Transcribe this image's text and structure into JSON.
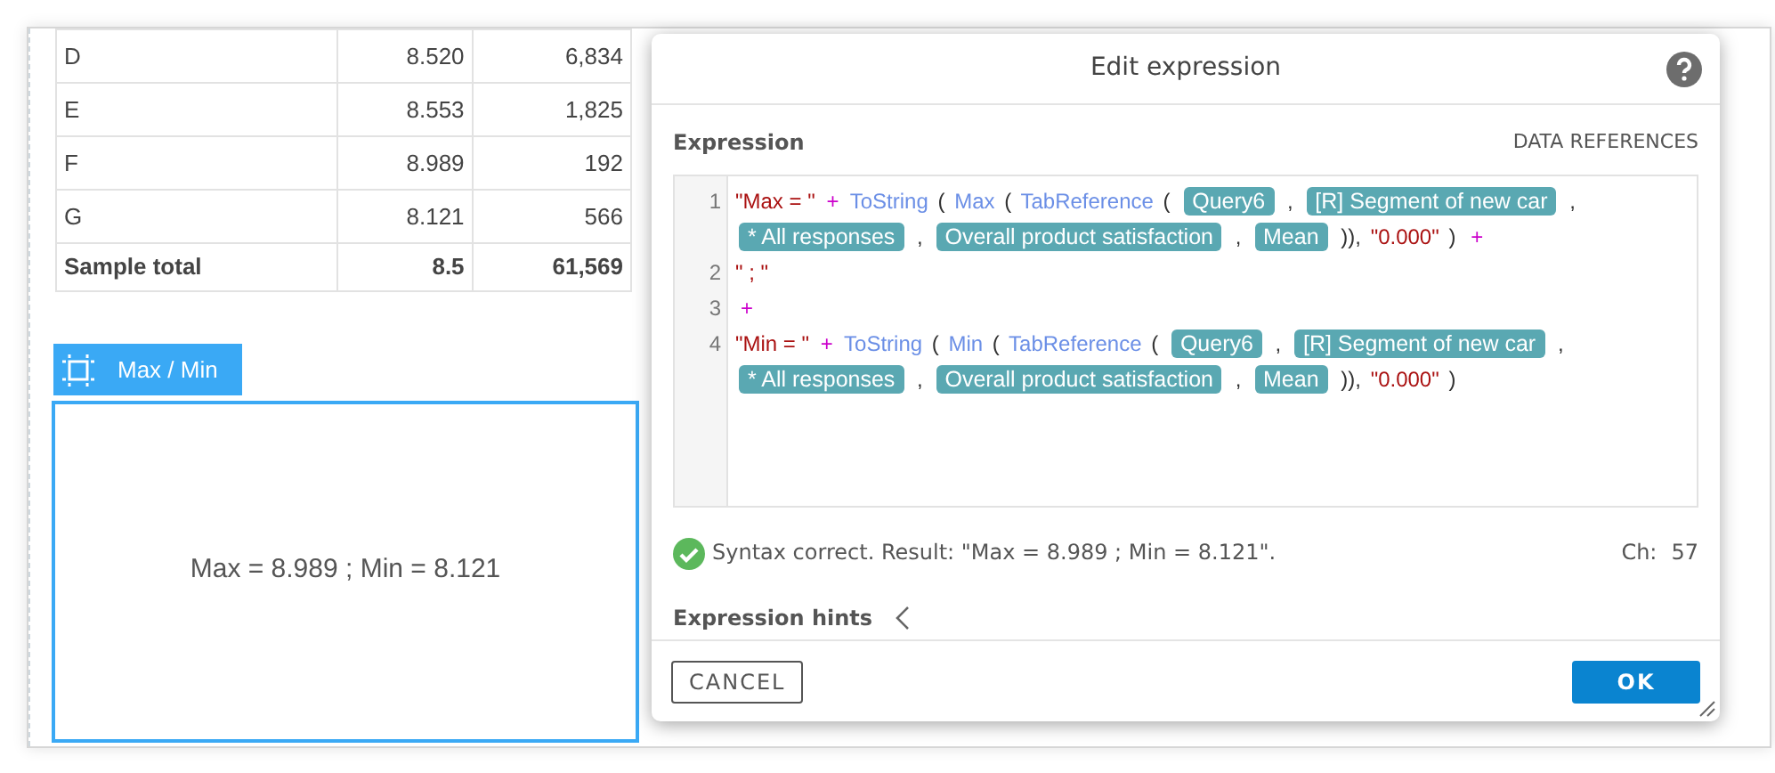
{
  "table": {
    "rows": [
      {
        "cells": [
          "D",
          "8.520",
          "6,834"
        ],
        "total": false
      },
      {
        "cells": [
          "E",
          "8.553",
          "1,825"
        ],
        "total": false
      },
      {
        "cells": [
          "F",
          "8.989",
          "192"
        ],
        "total": false
      },
      {
        "cells": [
          "G",
          "8.121",
          "566"
        ],
        "total": false
      },
      {
        "cells": [
          "Sample total",
          "8.5",
          "61,569"
        ],
        "total": true
      }
    ]
  },
  "widget": {
    "tab_label": "Max / Min",
    "selected": true,
    "text": "Max = 8.989 ; Min = 8.121"
  },
  "dialog": {
    "title": "Edit expression",
    "section_label": "Expression",
    "data_references": "DATA REFERENCES",
    "lines": [
      {
        "number": "1",
        "segments": [
          {
            "kind": "string",
            "text": "\"Max = \""
          },
          {
            "kind": "op",
            "text": "+"
          },
          {
            "kind": "func",
            "text": "ToString"
          },
          {
            "kind": "punct",
            "text": "("
          },
          {
            "kind": "func",
            "text": "Max"
          },
          {
            "kind": "punct",
            "text": "("
          },
          {
            "kind": "func",
            "text": "TabReference"
          },
          {
            "kind": "punct",
            "text": "("
          },
          {
            "kind": "ref",
            "text": "Query6"
          },
          {
            "kind": "punct",
            "text": ","
          },
          {
            "kind": "ref",
            "text": "[R] Segment of new car"
          },
          {
            "kind": "punct",
            "text": ","
          },
          {
            "kind": "ref",
            "text": "* All responses"
          },
          {
            "kind": "punct",
            "text": ","
          },
          {
            "kind": "ref",
            "text": "Overall product satisfaction"
          },
          {
            "kind": "punct",
            "text": ","
          },
          {
            "kind": "ref",
            "text": "Mean"
          },
          {
            "kind": "punct",
            "text": ")),"
          },
          {
            "kind": "string",
            "text": "\"0.000\""
          },
          {
            "kind": "punct",
            "text": ")"
          },
          {
            "kind": "op",
            "text": "+"
          }
        ]
      },
      {
        "number": "2",
        "segments": [
          {
            "kind": "string",
            "text": "\" ; \""
          }
        ]
      },
      {
        "number": "3",
        "segments": [
          {
            "kind": "op",
            "text": "+"
          }
        ]
      },
      {
        "number": "4",
        "segments": [
          {
            "kind": "string",
            "text": "\"Min = \""
          },
          {
            "kind": "op",
            "text": "+"
          },
          {
            "kind": "func",
            "text": "ToString"
          },
          {
            "kind": "punct",
            "text": "("
          },
          {
            "kind": "func",
            "text": "Min"
          },
          {
            "kind": "punct",
            "text": "("
          },
          {
            "kind": "func",
            "text": "TabReference"
          },
          {
            "kind": "punct",
            "text": "("
          },
          {
            "kind": "ref",
            "text": "Query6"
          },
          {
            "kind": "punct",
            "text": ","
          },
          {
            "kind": "ref",
            "text": "[R] Segment of new car"
          },
          {
            "kind": "punct",
            "text": ","
          },
          {
            "kind": "ref",
            "text": "* All responses"
          },
          {
            "kind": "punct",
            "text": ","
          },
          {
            "kind": "ref",
            "text": "Overall product satisfaction"
          },
          {
            "kind": "punct",
            "text": ","
          },
          {
            "kind": "ref",
            "text": "Mean"
          },
          {
            "kind": "punct",
            "text": ")),"
          },
          {
            "kind": "string",
            "text": "\"0.000\""
          },
          {
            "kind": "punct",
            "text": ")"
          }
        ]
      }
    ],
    "status": {
      "ok": true,
      "message": "Syntax correct. Result: \"Max = 8.989 ; Min = 8.121\".",
      "count_label": "Ch:",
      "count": "57"
    },
    "hints_label": "Expression hints",
    "hints_expanded": false,
    "buttons": {
      "cancel": "CANCEL",
      "ok": "OK"
    }
  }
}
